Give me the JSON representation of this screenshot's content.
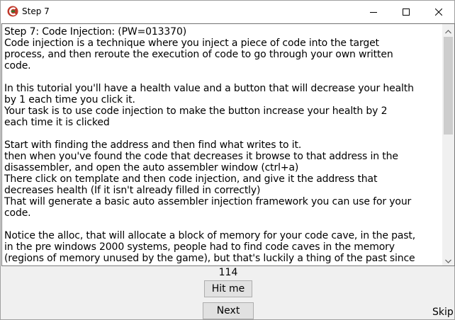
{
  "window": {
    "title": "Step 7",
    "app_icon": "cheat-engine-icon",
    "controls": [
      "minimize-icon",
      "maximize-icon",
      "close-icon"
    ]
  },
  "tutorial": {
    "text": "Step 7: Code Injection: (PW=013370)\nCode injection is a technique where you inject a piece of code into the target\nprocess, and then reroute the execution of code to go through your own written\ncode.\n\nIn this tutorial you'll have a health value and a button that will decrease your health\nby 1 each time you click it.\nYour task is to use code injection to make the button increase your health by 2\neach time it is clicked\n\nStart with finding the address and then find what writes to it.\nthen when you've found the code that decreases it browse to that address in the\ndisassembler, and open the auto assembler window (ctrl+a)\nThere click on template and then code injection, and give it the address that\ndecreases health (If it isn't already filled in correctly)\nThat will generate a basic auto assembler injection framework you can use for your\ncode.\n\nNotice the alloc, that will allocate a block of memory for your code cave, in the past,\nin the pre windows 2000 systems, people had to find code caves in the memory\n(regions of memory unused by the game), but that's luckily a thing of the past since"
  },
  "health_value": "114",
  "buttons": {
    "hit_label": "Hit me",
    "next_label": "Next",
    "skip_label": "Skip"
  }
}
